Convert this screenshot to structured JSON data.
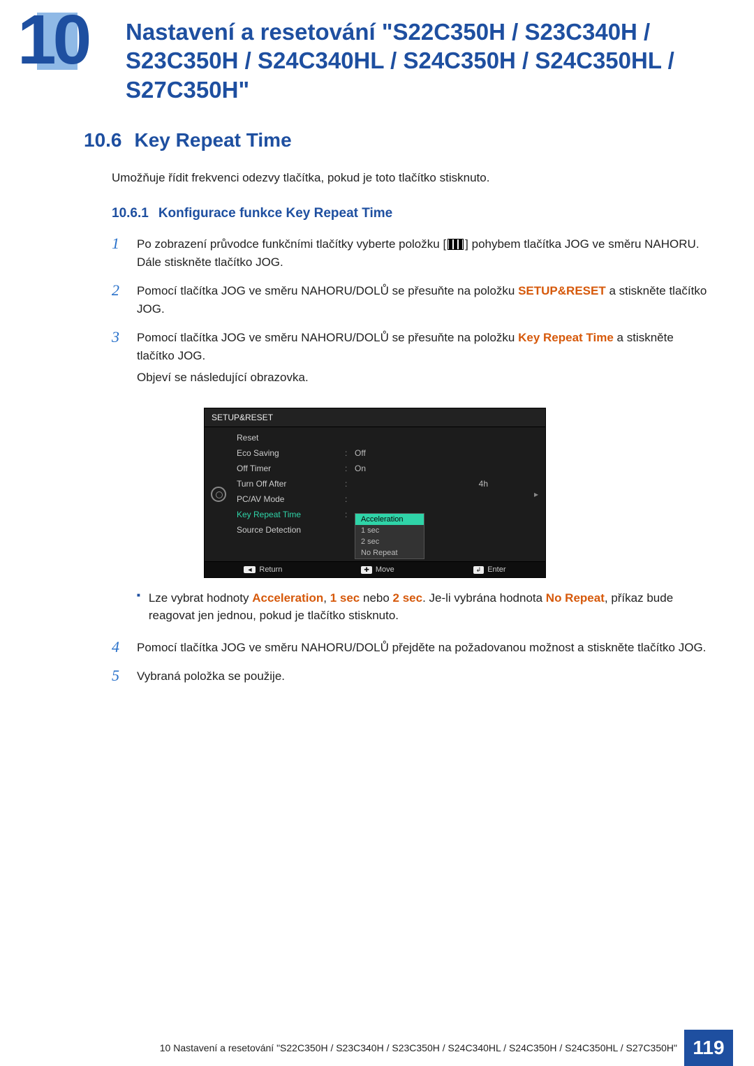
{
  "chapter": {
    "number": "10",
    "title": "Nastavení a resetování \"S22C350H / S23C340H / S23C350H / S24C340HL / S24C350H / S24C350HL / S27C350H\""
  },
  "section": {
    "number": "10.6",
    "title": "Key Repeat Time",
    "description": "Umožňuje řídit frekvenci odezvy tlačítka, pokud je toto tlačítko stisknuto."
  },
  "subsection": {
    "number": "10.6.1",
    "title": "Konfigurace funkce Key Repeat Time"
  },
  "steps": {
    "s1a": "Po zobrazení průvodce funkčními tlačítky vyberte položku [",
    "s1b": "] pohybem tlačítka JOG ve směru NAHORU. Dále stiskněte tlačítko JOG.",
    "s2a": "Pomocí tlačítka JOG ve směru NAHORU/DOLŮ se přesuňte na položku ",
    "s2b": "SETUP&RESET",
    "s2c": " a stiskněte tlačítko JOG.",
    "s3a": "Pomocí tlačítka JOG ve směru NAHORU/DOLŮ se přesuňte na položku ",
    "s3b": "Key Repeat Time",
    "s3c": " a stiskněte tlačítko JOG.",
    "s3after": "Objeví se následující obrazovka.",
    "bullet_a": "Lze vybrat hodnoty ",
    "bullet_acc": "Acceleration",
    "bullet_comma": ", ",
    "bullet_1s": "1 sec",
    "bullet_nebo": " nebo ",
    "bullet_2s": "2 sec",
    "bullet_b": ". Je-li vybrána hodnota ",
    "bullet_nr": "No Repeat",
    "bullet_c": ", příkaz bude reagovat jen jednou, pokud je tlačítko stisknuto.",
    "s4": "Pomocí tlačítka JOG ve směru NAHORU/DOLŮ přejděte na požadovanou možnost a stiskněte tlačítko JOG.",
    "s5": "Vybraná položka se použije.",
    "n1": "1",
    "n2": "2",
    "n3": "3",
    "n4": "4",
    "n5": "5"
  },
  "osd": {
    "title": "SETUP&RESET",
    "rows": {
      "reset": "Reset",
      "eco": "Eco Saving",
      "eco_v": "Off",
      "offtimer": "Off Timer",
      "offtimer_v": "On",
      "turnoff": "Turn Off After",
      "turnoff_v": "4h",
      "pcav": "PC/AV Mode",
      "keyrep": "Key Repeat Time",
      "source": "Source Detection"
    },
    "popup": {
      "acc": "Acceleration",
      "one": "1 sec",
      "two": "2 sec",
      "nr": "No Repeat"
    },
    "footer": {
      "ret": "Return",
      "mov": "Move",
      "ent": "Enter",
      "ret_i": "◄",
      "mov_i": "✚",
      "ent_i": "↲"
    },
    "colon": ":",
    "arrow": "▸"
  },
  "footer": {
    "text": "10 Nastavení a resetování \"S22C350H / S23C340H / S23C350H / S24C340HL / S24C350H / S24C350HL / S27C350H\"",
    "page": "119"
  }
}
